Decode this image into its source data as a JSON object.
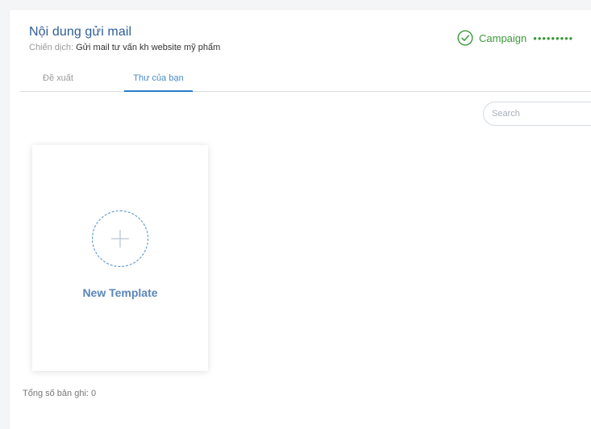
{
  "header": {
    "title": "Nội dung gửi mail",
    "campaign_label": "Chiến dịch:",
    "campaign_value": "Gửi mail tư vấn kh website mỹ phẩm"
  },
  "steps": {
    "current_label": "Campaign",
    "current_icon": "check-circle-icon",
    "next_indicator": "•••••••••",
    "color": "#3a9a3a"
  },
  "tabs": [
    {
      "label": "Đề xuất",
      "active": false
    },
    {
      "label": "Thư của bạn",
      "active": true
    }
  ],
  "search": {
    "placeholder": "Search",
    "value": ""
  },
  "templates": {
    "new_template_label": "New Template",
    "new_template_icon": "plus-icon"
  },
  "footer": {
    "total_label": "Tổng số bản ghi:",
    "total_count": "0"
  },
  "colors": {
    "accent": "#2b7cc7",
    "title": "#2f5f98",
    "success": "#3a9a3a"
  }
}
